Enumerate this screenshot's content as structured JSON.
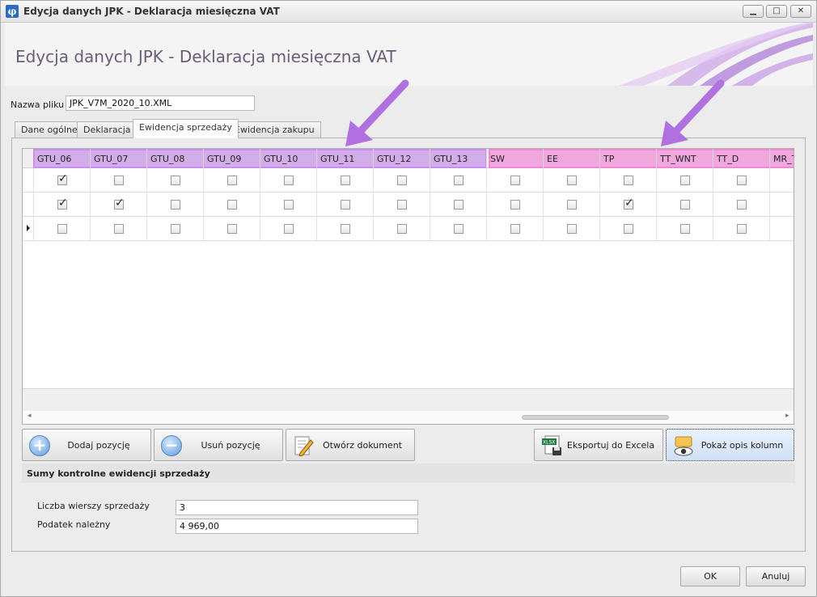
{
  "window": {
    "title": "Edycja danych JPK - Deklaracja miesięczna VAT",
    "app_icon": "φ"
  },
  "banner": {
    "title": "Edycja danych JPK - Deklaracja miesięczna VAT"
  },
  "file": {
    "label": "Nazwa pliku",
    "value": "JPK_V7M_2020_10.XML"
  },
  "tabs": [
    {
      "label": "Dane ogólne",
      "active": false
    },
    {
      "label": "Deklaracja",
      "active": false
    },
    {
      "label": "Ewidencja sprzedaży",
      "active": true
    },
    {
      "label": "Ewidencja zakupu",
      "active": false
    }
  ],
  "grid": {
    "columns": [
      "GTU_06",
      "GTU_07",
      "GTU_08",
      "GTU_09",
      "GTU_10",
      "GTU_11",
      "GTU_12",
      "GTU_13",
      "SW",
      "EE",
      "TP",
      "TT_WNT",
      "TT_D",
      "MR_T"
    ],
    "rows": [
      [
        true,
        false,
        false,
        false,
        false,
        false,
        false,
        false,
        false,
        false,
        false,
        false,
        false
      ],
      [
        true,
        true,
        false,
        false,
        false,
        false,
        false,
        false,
        false,
        false,
        true,
        false,
        false
      ],
      [
        false,
        false,
        false,
        false,
        false,
        false,
        false,
        false,
        false,
        false,
        false,
        false,
        false
      ]
    ],
    "current_row": 2
  },
  "buttons": {
    "add": "Dodaj pozycję",
    "remove": "Usuń pozycję",
    "open": "Otwórz dokument",
    "export": "Eksportuj do Excela",
    "describe": "Pokaż opis kolumn",
    "xlsx_badge": "XLSX"
  },
  "summary": {
    "title": "Sumy kontrolne ewidencji sprzedaży",
    "rows_label": "Liczba wierszy sprzedaży",
    "rows_value": "3",
    "tax_label": "Podatek należny",
    "tax_value": "4 969,00"
  },
  "dialog": {
    "ok": "OK",
    "cancel": "Anuluj"
  },
  "colors": {
    "highlight_purple": "#be78e6",
    "highlight_pink": "#f078d2",
    "arrow": "#b070e0"
  }
}
